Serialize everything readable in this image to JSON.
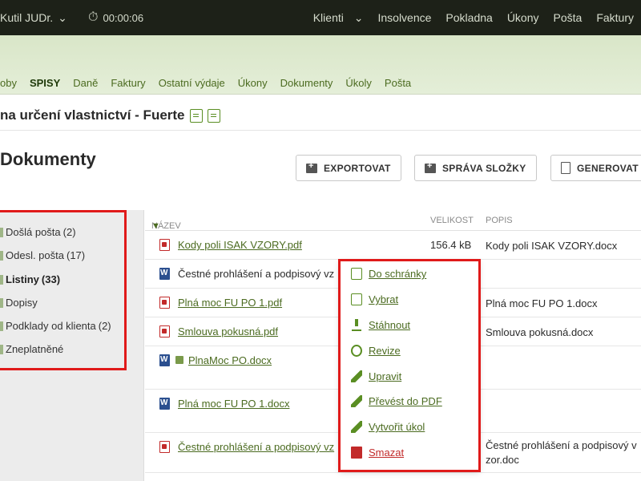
{
  "topbar": {
    "user": "Kutil JUDr.",
    "timer": "00:00:06",
    "nav": [
      "Klienti",
      "Insolvence",
      "Pokladna",
      "Úkony",
      "Pošta",
      "Faktury"
    ]
  },
  "tabs": [
    {
      "label": "oby",
      "active": false
    },
    {
      "label": "SPISY",
      "active": true
    },
    {
      "label": "Daně",
      "active": false
    },
    {
      "label": "Faktury",
      "active": false
    },
    {
      "label": "Ostatní výdaje",
      "active": false
    },
    {
      "label": "Úkony",
      "active": false
    },
    {
      "label": "Dokumenty",
      "active": false
    },
    {
      "label": "Úkoly",
      "active": false
    },
    {
      "label": "Pošta",
      "active": false
    }
  ],
  "case_title": "na určení vlastnictví - Fuerte",
  "section_title": "Dokumenty",
  "buttons": {
    "export": "EXPORTOVAT",
    "folders": "SPRÁVA SLOŽKY",
    "generate": "GENEROVAT"
  },
  "folders": [
    {
      "label": "Došlá pošta",
      "count": "(2)",
      "active": false
    },
    {
      "label": "Odesl. pošta",
      "count": "(17)",
      "active": false
    },
    {
      "label": "Listiny",
      "count": "(33)",
      "active": true
    },
    {
      "label": "Dopisy",
      "count": "",
      "active": false
    },
    {
      "label": "Podklady od klienta",
      "count": "(2)",
      "active": false
    },
    {
      "label": "Zneplatněné",
      "count": "",
      "active": false
    }
  ],
  "table": {
    "headers": {
      "name": "NÁZEV",
      "sort": "▼",
      "size": "VELIKOST",
      "desc": "POPIS"
    },
    "rows": [
      {
        "type": "pdf",
        "name": "Kody poli ISAK VZORY.pdf",
        "size": "156.4 kB",
        "desc": "Kody poli ISAK VZORY.docx",
        "link": true
      },
      {
        "type": "doc",
        "name": "Čestné prohlášení a podpisový vz",
        "size": "",
        "desc": "",
        "link": false
      },
      {
        "type": "pdf",
        "name": "Plná moc FU PO 1.pdf",
        "size": "",
        "desc": "Plná moc FU PO 1.docx",
        "link": true
      },
      {
        "type": "pdf",
        "name": "Smlouva pokusná.pdf",
        "size": "",
        "desc": "Smlouva pokusná.docx",
        "link": true
      },
      {
        "type": "doc",
        "name": "PlnaMoc PO.docx",
        "size": "",
        "desc": "",
        "link": true,
        "locked": true
      },
      {
        "type": "doc",
        "name": "Plná moc FU PO 1.docx",
        "size": "",
        "desc": "",
        "link": true
      },
      {
        "type": "pdf",
        "name": "Čestné prohlášení a podpisový vz",
        "size": "",
        "desc": "Čestné prohlášení a podpisový v zor.doc",
        "link": true
      }
    ]
  },
  "context_menu": [
    {
      "label": "Do schránky",
      "icon": "copy-icon"
    },
    {
      "label": "Vybrat",
      "icon": "copy-icon"
    },
    {
      "label": "Stáhnout",
      "icon": "download-icon"
    },
    {
      "label": "Revize",
      "icon": "history-icon"
    },
    {
      "label": "Upravit",
      "icon": "pencil-icon"
    },
    {
      "label": "Převést do PDF",
      "icon": "pencil-icon"
    },
    {
      "label": "Vytvořit úkol",
      "icon": "pencil-icon"
    },
    {
      "label": "Smazat",
      "icon": "trash-icon",
      "danger": true
    }
  ]
}
